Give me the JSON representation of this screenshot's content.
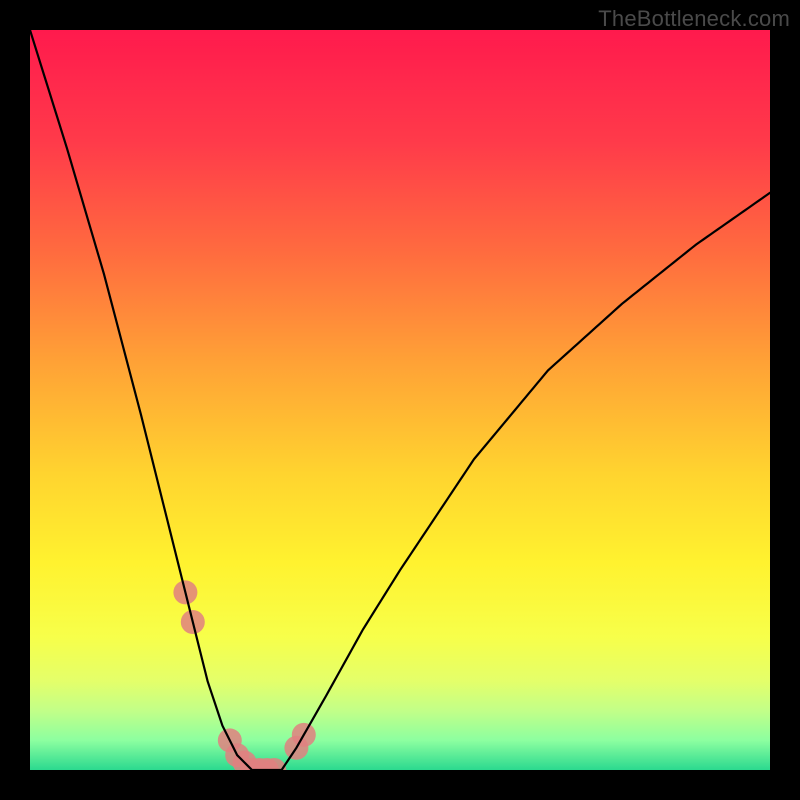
{
  "watermark": "TheBottleneck.com",
  "chart_data": {
    "type": "line",
    "title": "",
    "xlabel": "",
    "ylabel": "",
    "xlim": [
      0,
      100
    ],
    "ylim": [
      0,
      100
    ],
    "x": [
      0,
      5,
      10,
      15,
      20,
      22,
      24,
      26,
      28,
      30,
      31,
      32,
      34,
      36,
      40,
      45,
      50,
      60,
      70,
      80,
      90,
      100
    ],
    "y": [
      100,
      84,
      67,
      48,
      28,
      20,
      12,
      6,
      2,
      0,
      0,
      0,
      0,
      3,
      10,
      19,
      27,
      42,
      54,
      63,
      71,
      78
    ],
    "gradient_stops": [
      {
        "offset": 0.0,
        "color": "#ff1a4d"
      },
      {
        "offset": 0.15,
        "color": "#ff3a4a"
      },
      {
        "offset": 0.3,
        "color": "#ff6b3f"
      },
      {
        "offset": 0.45,
        "color": "#ffa236"
      },
      {
        "offset": 0.6,
        "color": "#ffd42f"
      },
      {
        "offset": 0.72,
        "color": "#fff22f"
      },
      {
        "offset": 0.82,
        "color": "#f7ff4a"
      },
      {
        "offset": 0.88,
        "color": "#e4ff6a"
      },
      {
        "offset": 0.92,
        "color": "#c2ff88"
      },
      {
        "offset": 0.96,
        "color": "#8cffa0"
      },
      {
        "offset": 1.0,
        "color": "#2bd98f"
      }
    ],
    "markers_x": [
      21,
      22,
      27,
      28,
      29,
      30,
      31,
      32,
      33,
      36,
      37
    ],
    "marker_color": "#e08080",
    "marker_radius": 12
  }
}
